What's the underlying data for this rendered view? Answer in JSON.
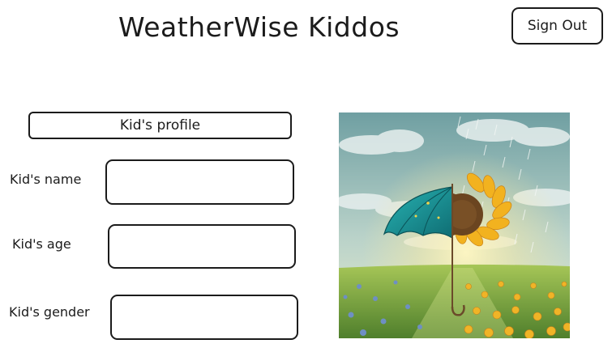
{
  "header": {
    "title": "WeatherWise Kiddos",
    "sign_out_label": "Sign Out"
  },
  "profile": {
    "section_title": "Kid's profile",
    "fields": [
      {
        "label": "Kid's name",
        "value": ""
      },
      {
        "label": "Kid's age",
        "value": ""
      },
      {
        "label": "Kid's gender",
        "value": ""
      }
    ]
  },
  "illustration": {
    "icon": "umbrella-sunflower-rain-illustration"
  },
  "colors": {
    "ink": "#1b1b1b",
    "sky": "#8fb6b5",
    "umbrella": "#1a9a9b",
    "sunflower": "#f2b21f",
    "grass": "#7da53a"
  }
}
